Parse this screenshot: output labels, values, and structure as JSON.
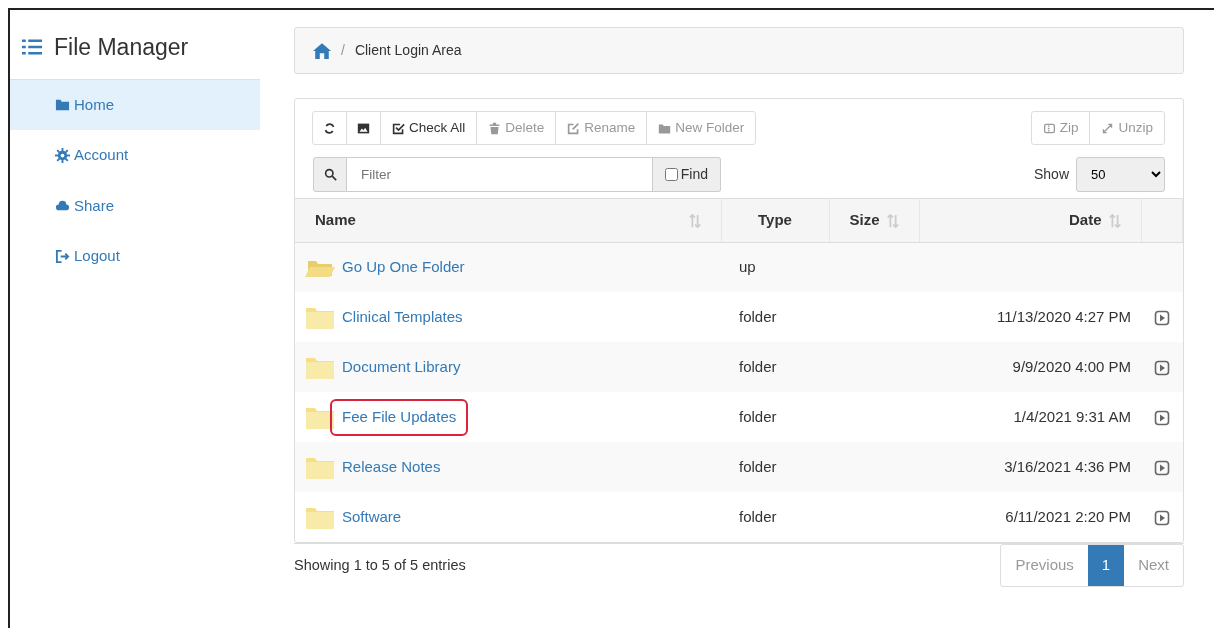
{
  "sidebar": {
    "title": "File Manager",
    "items": [
      {
        "label": "Home",
        "selected": true
      },
      {
        "label": "Account",
        "selected": false
      },
      {
        "label": "Share",
        "selected": false
      },
      {
        "label": "Logout",
        "selected": false
      }
    ]
  },
  "breadcrumb": {
    "separator": "/",
    "items": [
      "Client Login Area"
    ]
  },
  "toolbar": {
    "left": [
      {
        "disabled": false
      },
      {
        "disabled": false
      },
      {
        "label": "Check All",
        "disabled": false
      },
      {
        "label": "Delete",
        "disabled": true
      },
      {
        "label": "Rename",
        "disabled": true
      },
      {
        "label": "New Folder",
        "disabled": true
      }
    ],
    "right": [
      {
        "label": "Zip",
        "disabled": true
      },
      {
        "label": "Unzip",
        "disabled": true
      }
    ]
  },
  "filter": {
    "placeholder": "Filter",
    "find_label": "Find",
    "find_checked": false
  },
  "show": {
    "label": "Show",
    "value": "50"
  },
  "table": {
    "columns": [
      {
        "label": "Name",
        "sortable": true
      },
      {
        "label": "Type",
        "sortable": false
      },
      {
        "label": "Size",
        "sortable": true
      },
      {
        "label": "Date",
        "sortable": true
      }
    ],
    "rows": [
      {
        "kind": "up",
        "name": "Go Up One Folder",
        "type": "up",
        "date": null,
        "highlighted": false
      },
      {
        "kind": "folder",
        "name": "Clinical Templates",
        "type": "folder",
        "date": "11/13/2020 4:27 PM",
        "highlighted": false
      },
      {
        "kind": "folder",
        "name": "Document Library",
        "type": "folder",
        "date": "9/9/2020 4:00 PM",
        "highlighted": false
      },
      {
        "kind": "folder",
        "name": "Fee File Updates",
        "type": "folder",
        "date": "1/4/2021 9:31 AM",
        "highlighted": true
      },
      {
        "kind": "folder",
        "name": "Release Notes",
        "type": "folder",
        "date": "3/16/2021 4:36 PM",
        "highlighted": false
      },
      {
        "kind": "folder",
        "name": "Software",
        "type": "folder",
        "date": "6/11/2021 2:20 PM",
        "highlighted": false
      }
    ]
  },
  "footer": {
    "info": "Showing 1 to 5 of 5 entries",
    "pagination": [
      {
        "label": "Previous",
        "selected": false
      },
      {
        "label": "1",
        "selected": true
      },
      {
        "label": "Next",
        "selected": false
      }
    ]
  }
}
